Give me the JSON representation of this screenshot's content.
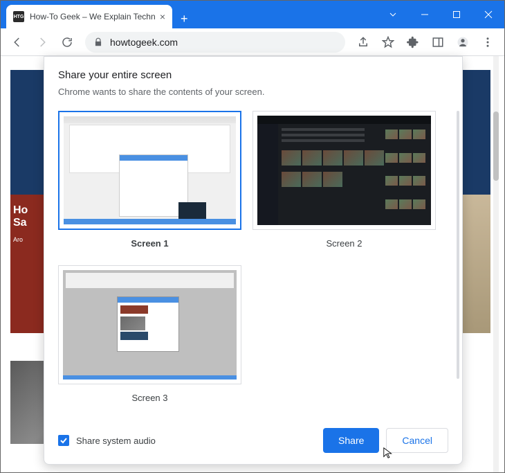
{
  "window": {
    "tab_favicon": "HTG",
    "tab_title": "How-To Geek – We Explain Techn",
    "url_domain": "howtogeek.com"
  },
  "page_hero": {
    "line1": "Ho",
    "line2": "Sa",
    "sub": "Aro"
  },
  "dialog": {
    "title": "Share your entire screen",
    "subtitle": "Chrome wants to share the contents of your screen.",
    "screens": [
      {
        "label": "Screen 1",
        "selected": true
      },
      {
        "label": "Screen 2",
        "selected": false
      },
      {
        "label": "Screen 3",
        "selected": false
      }
    ],
    "audio_checkbox_label": "Share system audio",
    "audio_checked": true,
    "share_button": "Share",
    "cancel_button": "Cancel"
  }
}
